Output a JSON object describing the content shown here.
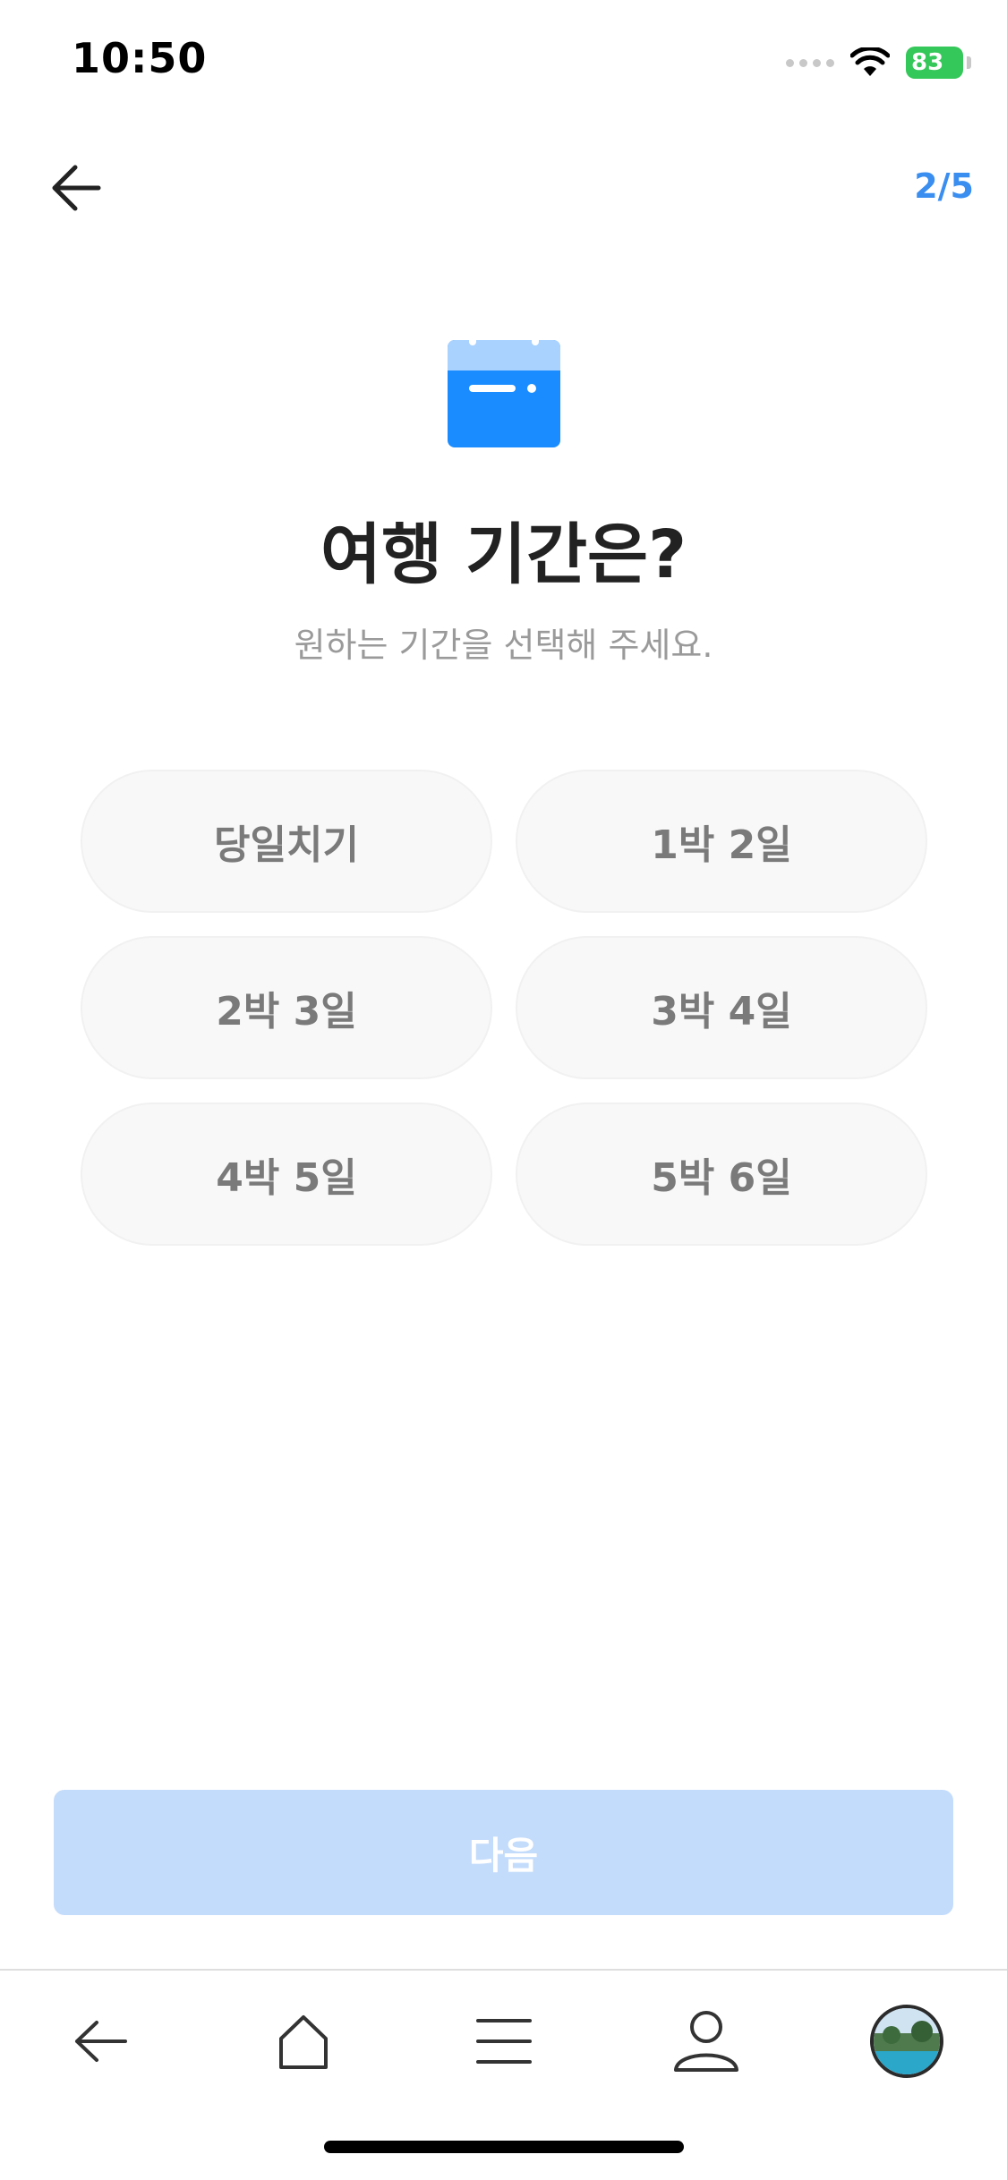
{
  "status_bar": {
    "time": "10:50",
    "battery": "83"
  },
  "header": {
    "step": "2/5"
  },
  "main": {
    "title": "여행 기간은?",
    "subtitle": "원하는 기간을 선택해 주세요.",
    "options": [
      {
        "label": "당일치기"
      },
      {
        "label": "1박 2일"
      },
      {
        "label": "2박 3일"
      },
      {
        "label": "3박 4일"
      },
      {
        "label": "4박 5일"
      },
      {
        "label": "5박 6일"
      }
    ],
    "next_label": "다음"
  },
  "colors": {
    "accent": "#3a8ef0",
    "icon_blue": "#1a8cff",
    "next_disabled": "#c4dcfb",
    "battery_green": "#34c759"
  },
  "icons": {
    "header_back": "arrow-left-icon",
    "hero": "calendar-icon",
    "nav": [
      "arrow-left-icon",
      "home-icon",
      "menu-icon",
      "person-icon",
      "avatar"
    ]
  }
}
